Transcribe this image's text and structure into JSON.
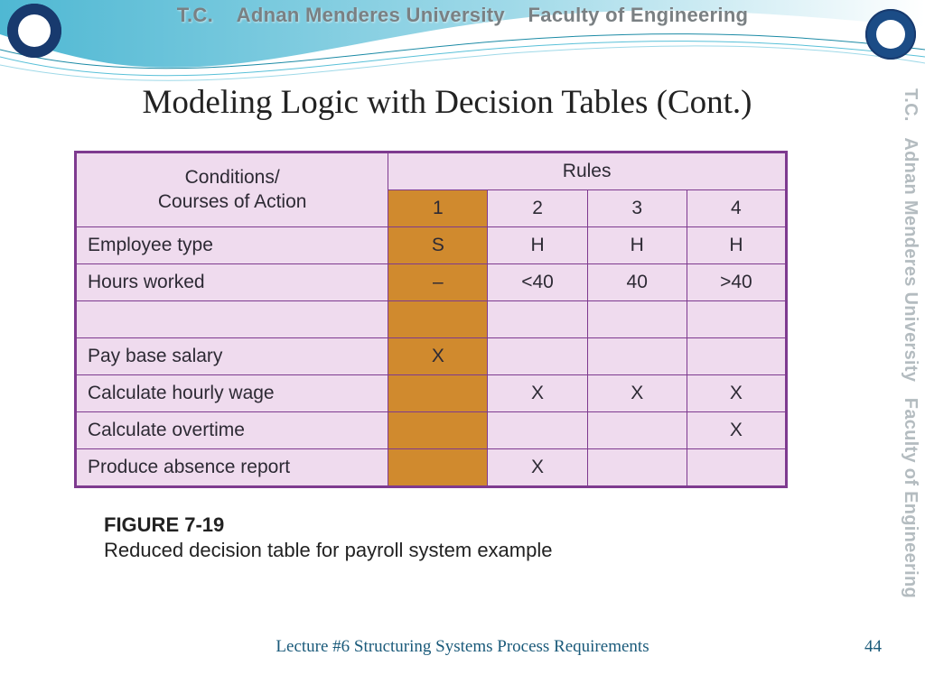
{
  "header": {
    "org_line": "T.C.    Adnan Menderes University    Faculty of Engineering"
  },
  "side_text": "T.C.   Adnan Menderes University   Faculty of Engineering",
  "title": "Modeling Logic with Decision Tables (Cont.)",
  "table": {
    "conditions_header_l1": "Conditions/",
    "conditions_header_l2": "Courses of Action",
    "rules_header": "Rules",
    "rule_nums": [
      "1",
      "2",
      "3",
      "4"
    ],
    "rows": [
      {
        "label": "Employee type",
        "cells": [
          "S",
          "H",
          "H",
          "H"
        ]
      },
      {
        "label": "Hours worked",
        "cells": [
          "–",
          "<40",
          "40",
          ">40"
        ]
      },
      {
        "label": "",
        "cells": [
          "",
          "",
          "",
          ""
        ]
      },
      {
        "label": "Pay base salary",
        "cells": [
          "X",
          "",
          "",
          ""
        ]
      },
      {
        "label": "Calculate hourly wage",
        "cells": [
          "",
          "X",
          "X",
          "X"
        ]
      },
      {
        "label": "Calculate overtime",
        "cells": [
          "",
          "",
          "",
          "X"
        ]
      },
      {
        "label": "Produce absence report",
        "cells": [
          "",
          "X",
          "",
          ""
        ]
      }
    ]
  },
  "caption": {
    "figure_label": "FIGURE 7-19",
    "text": "Reduced decision table for payroll system example"
  },
  "footer": {
    "lecture": "Lecture #6 Structuring Systems Process Requirements",
    "page": "44"
  },
  "chart_data": {
    "type": "table",
    "title": "Reduced decision table for payroll system example",
    "columns": [
      "Conditions/Courses of Action",
      "Rule 1",
      "Rule 2",
      "Rule 3",
      "Rule 4"
    ],
    "rows": [
      [
        "Employee type",
        "S",
        "H",
        "H",
        "H"
      ],
      [
        "Hours worked",
        "-",
        "<40",
        "40",
        ">40"
      ],
      [
        "Pay base salary",
        "X",
        "",
        "",
        ""
      ],
      [
        "Calculate hourly wage",
        "",
        "X",
        "X",
        "X"
      ],
      [
        "Calculate overtime",
        "",
        "",
        "",
        "X"
      ],
      [
        "Produce absence report",
        "",
        "X",
        "",
        ""
      ]
    ]
  }
}
